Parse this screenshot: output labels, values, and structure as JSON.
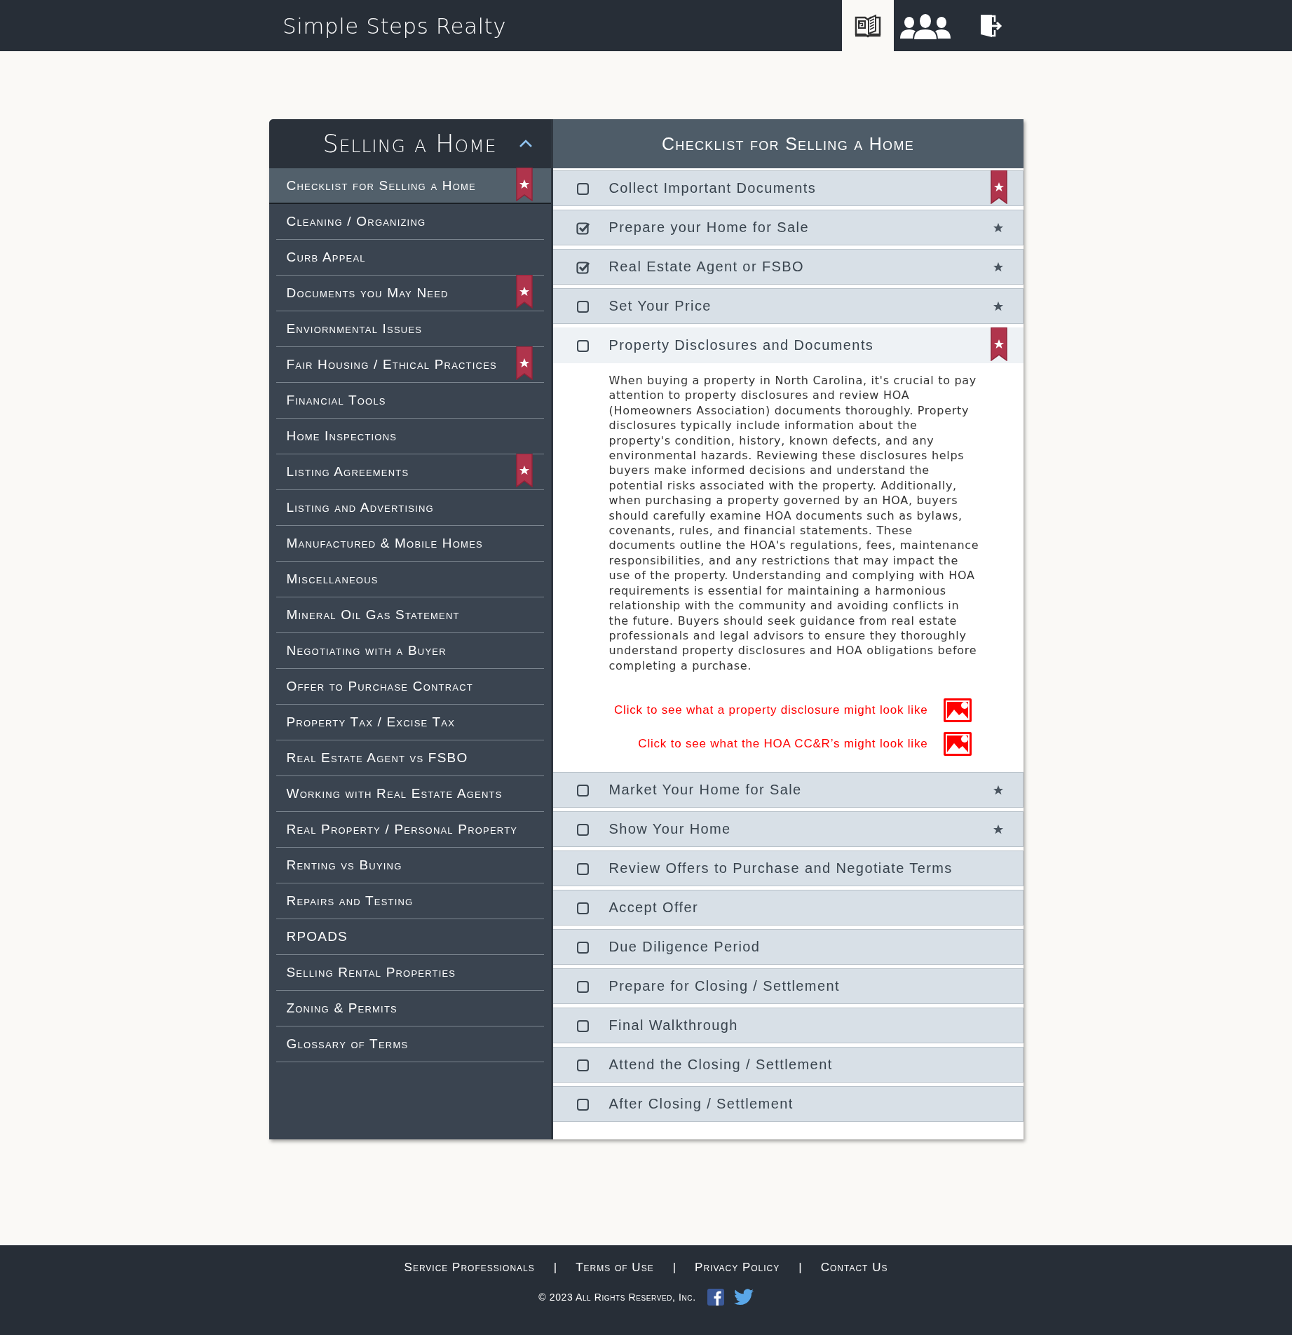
{
  "header": {
    "title": "Simple Steps Realty",
    "tools": [
      {
        "kind": "guide",
        "selected": true
      },
      {
        "kind": "people",
        "selected": false
      },
      {
        "kind": "exit",
        "selected": false
      }
    ]
  },
  "sidebar": {
    "title": "Selling a Home",
    "expanded": true,
    "items": [
      {
        "label": "Checklist for Selling a Home",
        "selected": true,
        "bookmarked": true
      },
      {
        "label": "Cleaning / Organizing",
        "selected": false,
        "bookmarked": false
      },
      {
        "label": "Curb Appeal",
        "selected": false,
        "bookmarked": false
      },
      {
        "label": "Documents you May Need",
        "selected": false,
        "bookmarked": true
      },
      {
        "label": "Enviornmental Issues",
        "selected": false,
        "bookmarked": false
      },
      {
        "label": "Fair Housing / Ethical Practices",
        "selected": false,
        "bookmarked": true
      },
      {
        "label": "Financial Tools",
        "selected": false,
        "bookmarked": false
      },
      {
        "label": "Home Inspections",
        "selected": false,
        "bookmarked": false
      },
      {
        "label": "Listing Agreements",
        "selected": false,
        "bookmarked": true
      },
      {
        "label": "Listing and Advertising",
        "selected": false,
        "bookmarked": false
      },
      {
        "label": "Manufactured & Mobile Homes",
        "selected": false,
        "bookmarked": false
      },
      {
        "label": "Miscellaneous",
        "selected": false,
        "bookmarked": false
      },
      {
        "label": "Mineral Oil Gas Statement",
        "selected": false,
        "bookmarked": false
      },
      {
        "label": "Negotiating with a Buyer",
        "selected": false,
        "bookmarked": false
      },
      {
        "label": "Offer to Purchase Contract",
        "selected": false,
        "bookmarked": false
      },
      {
        "label": "Property Tax / Excise Tax",
        "selected": false,
        "bookmarked": false
      },
      {
        "label": "Real Estate Agent vs FSBO",
        "selected": false,
        "bookmarked": false
      },
      {
        "label": "Working with Real Estate Agents",
        "selected": false,
        "bookmarked": false
      },
      {
        "label": "Real Property / Personal Property",
        "selected": false,
        "bookmarked": false
      },
      {
        "label": "Renting vs Buying",
        "selected": false,
        "bookmarked": false
      },
      {
        "label": "Repairs and Testing",
        "selected": false,
        "bookmarked": false
      },
      {
        "label": "RPOADS",
        "selected": false,
        "bookmarked": false
      },
      {
        "label": "Selling Rental Properties",
        "selected": false,
        "bookmarked": false
      },
      {
        "label": "Zoning & Permits",
        "selected": false,
        "bookmarked": false
      },
      {
        "label": "Glossary of Terms",
        "selected": false,
        "bookmarked": false
      }
    ]
  },
  "checklist": {
    "title": "Checklist for Selling a Home",
    "items": [
      {
        "label": "Collect Important Documents",
        "checked": false,
        "expanded": false,
        "favorite": true
      },
      {
        "label": "Prepare your Home for Sale",
        "checked": true,
        "expanded": false,
        "favorite": false
      },
      {
        "label": "Real Estate Agent or FSBO",
        "checked": true,
        "expanded": false,
        "favorite": false
      },
      {
        "label": "Set Your Price",
        "checked": false,
        "expanded": false,
        "favorite": false
      },
      {
        "label": "Property Disclosures and Documents",
        "checked": false,
        "expanded": true,
        "favorite": true,
        "details": {
          "text": "When buying a property in North Carolina, it's crucial to pay attention to property disclosures and review HOA (Homeowners Association) documents thoroughly. Property disclosures typically include information about the property's condition, history, known defects, and any environmental hazards. Reviewing these disclosures helps buyers make informed decisions and understand the potential risks associated with the property. Additionally, when purchasing a property governed by an HOA, buyers should carefully examine HOA documents such as bylaws, covenants, rules, and financial statements. These documents outline the HOA's regulations, fees, maintenance responsibilities, and any restrictions that may impact the use of the property. Understanding and complying with HOA requirements is essential for maintaining a harmonious relationship with the community and avoiding conflicts in the future. Buyers should seek guidance from real estate professionals and legal advisors to ensure they thoroughly understand property disclosures and HOA obligations before completing a purchase.",
          "links": [
            "Click to see what a property disclosure might look like",
            "Click to see what the HOA CC&R’s might look like"
          ]
        }
      },
      {
        "label": "Market Your Home for Sale",
        "checked": false,
        "expanded": false,
        "favorite": false
      },
      {
        "label": "Show Your Home",
        "checked": false,
        "expanded": false,
        "favorite": false
      },
      {
        "label": "Review Offers to Purchase and Negotiate Terms",
        "checked": false,
        "expanded": false
      },
      {
        "label": "Accept Offer",
        "checked": false,
        "expanded": false
      },
      {
        "label": "Due Diligence Period",
        "checked": false,
        "expanded": false
      },
      {
        "label": "Prepare for Closing / Settlement",
        "checked": false,
        "expanded": false
      },
      {
        "label": "Final Walkthrough",
        "checked": false,
        "expanded": false
      },
      {
        "label": "Attend the Closing / Settlement",
        "checked": false,
        "expanded": false
      },
      {
        "label": "After Closing / Settlement",
        "checked": false,
        "expanded": false
      }
    ]
  },
  "footer": {
    "links": [
      "Service Professionals",
      "Terms of Use",
      "Privacy Policy",
      "Contact Us"
    ],
    "separator": "|",
    "copyright": "© 2023 All Rights Reserved, Inc."
  }
}
